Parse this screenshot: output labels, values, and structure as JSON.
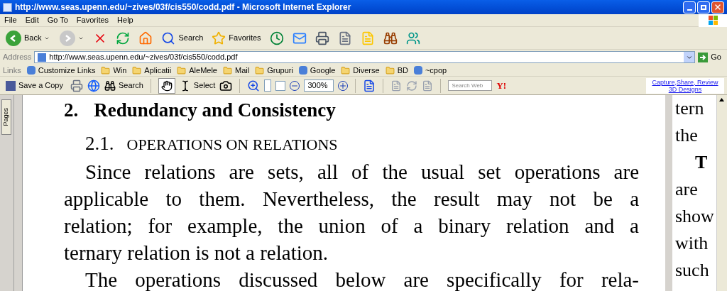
{
  "window": {
    "title": "http://www.seas.upenn.edu/~zives/03f/cis550/codd.pdf - Microsoft Internet Explorer"
  },
  "menu": [
    "File",
    "Edit",
    "Go To",
    "Favorites",
    "Help"
  ],
  "toolbar": [
    {
      "kind": "back",
      "label": "Back"
    },
    {
      "kind": "forward"
    },
    {
      "kind": "stop"
    },
    {
      "kind": "refresh"
    },
    {
      "kind": "home"
    },
    {
      "kind": "search",
      "label": "Search"
    },
    {
      "kind": "favorites",
      "label": "Favorites"
    },
    {
      "kind": "history"
    },
    {
      "kind": "mail"
    },
    {
      "kind": "print"
    },
    {
      "kind": "edit"
    },
    {
      "kind": "note"
    },
    {
      "kind": "research"
    },
    {
      "kind": "messenger"
    }
  ],
  "address": {
    "label": "Address",
    "value": "http://www.seas.upenn.edu/~zives/03f/cis550/codd.pdf",
    "go": "Go"
  },
  "links": {
    "label": "Links",
    "items": [
      {
        "kind": "page",
        "label": "Customize Links"
      },
      {
        "kind": "folder",
        "label": "Win"
      },
      {
        "kind": "folder",
        "label": "Aplicatii"
      },
      {
        "kind": "folder",
        "label": "AleMele"
      },
      {
        "kind": "folder",
        "label": "Mail"
      },
      {
        "kind": "folder",
        "label": "Grupuri"
      },
      {
        "kind": "page",
        "label": "Google"
      },
      {
        "kind": "folder",
        "label": "Diverse"
      },
      {
        "kind": "folder",
        "label": "BD"
      },
      {
        "kind": "page",
        "label": "~cpop"
      }
    ]
  },
  "pdf_toolbar": {
    "save": "Save a Copy",
    "search": "Search",
    "select": "Select",
    "zoom": "300%",
    "search_web": {
      "placeholder": "Search Web"
    },
    "yahoo": "Y!",
    "ad": [
      "Capture,Share, Review",
      "3D Designs"
    ]
  },
  "side_tab": "Pages",
  "page": {
    "heading_number": "2.",
    "heading": "Redundancy and Consistency",
    "subheading_number": "2.1.",
    "subheading": "OPERATIONS ON RELATIONS",
    "paragraph": [
      "Since relations are sets, all of the usual set operations are",
      "applicable to them. Nevertheless, the result may not be a",
      "relation; for example, the union of a binary relation and a",
      "ternary relation is not a relation."
    ],
    "next_line": "The operations discussed below are specifically for rela-"
  },
  "next_page": [
    "tern",
    "the",
    "T",
    "are",
    "show",
    "with",
    "such"
  ]
}
